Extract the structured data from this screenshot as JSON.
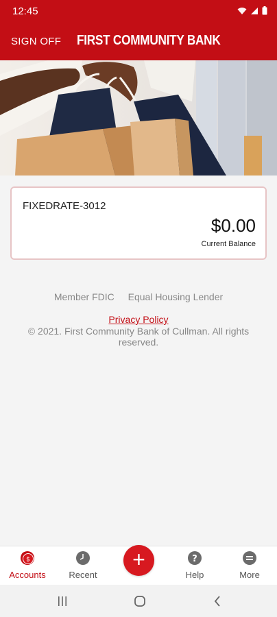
{
  "status_bar": {
    "time": "12:45"
  },
  "header": {
    "signoff_label": "SIGN OFF",
    "title": "FIRST COMMUNITY BANK"
  },
  "account": {
    "name": "FIXEDRATE-3012",
    "balance": "$0.00",
    "balance_label": "Current Balance"
  },
  "footer": {
    "member_fdic": "Member FDIC",
    "equal_housing": "Equal Housing Lender",
    "privacy_policy": "Privacy Policy",
    "copyright": "© 2021. First Community Bank of Cullman. All rights reserved."
  },
  "tabs": [
    {
      "label": "Accounts",
      "icon": "dollar-coins-icon",
      "active": true
    },
    {
      "label": "Recent",
      "icon": "clock-icon",
      "active": false
    },
    {
      "label": "Help",
      "icon": "question-icon",
      "active": false
    },
    {
      "label": "More",
      "icon": "menu-icon",
      "active": false
    }
  ],
  "fab": {
    "icon": "plus-icon",
    "symbol": "+"
  },
  "colors": {
    "brand_red": "#c30e15",
    "fab_red": "#d71920",
    "footer_gray": "#888888"
  }
}
